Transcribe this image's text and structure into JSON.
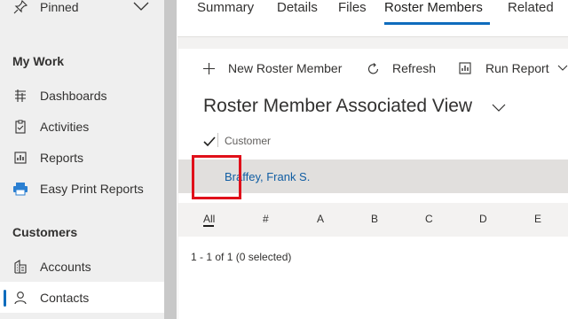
{
  "sidebar": {
    "pinned_label": "Pinned",
    "sections": [
      {
        "heading": "My Work",
        "items": [
          {
            "label": "Dashboards",
            "icon": "dashboard-icon"
          },
          {
            "label": "Activities",
            "icon": "clipboard-icon"
          },
          {
            "label": "Reports",
            "icon": "report-icon"
          },
          {
            "label": "Easy Print Reports",
            "icon": "print-icon"
          }
        ]
      },
      {
        "heading": "Customers",
        "items": [
          {
            "label": "Accounts",
            "icon": "building-icon"
          },
          {
            "label": "Contacts",
            "icon": "person-icon",
            "active": true
          }
        ]
      }
    ]
  },
  "tabs": [
    {
      "label": "Summary"
    },
    {
      "label": "Details"
    },
    {
      "label": "Files"
    },
    {
      "label": "Roster Members",
      "active": true
    },
    {
      "label": "Related"
    }
  ],
  "commands": {
    "new_label": "New Roster Member",
    "refresh_label": "Refresh",
    "run_report_label": "Run Report"
  },
  "view": {
    "title": "Roster Member Associated View",
    "column_header": "Customer",
    "rows": [
      {
        "customer": "Braffey, Frank S."
      }
    ]
  },
  "alpha_filter": [
    "All",
    "#",
    "A",
    "B",
    "C",
    "D",
    "E"
  ],
  "footer": {
    "status": "1 - 1 of 1 (0 selected)"
  },
  "colors": {
    "accent": "#0f6cbd",
    "link": "#115ea3",
    "highlight": "#e0101a"
  }
}
